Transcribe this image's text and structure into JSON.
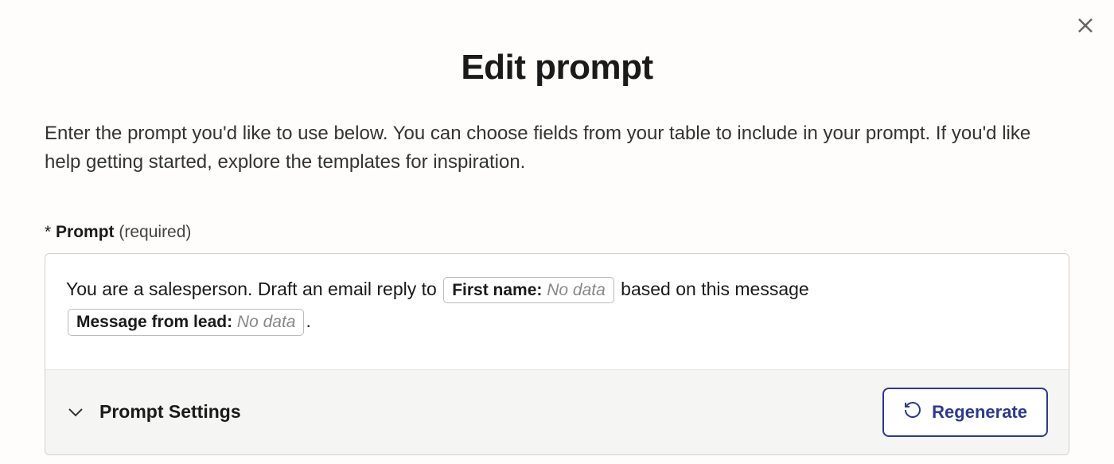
{
  "modal": {
    "title": "Edit prompt",
    "description": "Enter the prompt you'd like to use below. You can choose fields from your table to include in your prompt. If you'd like help getting started, explore the templates for inspiration."
  },
  "prompt": {
    "asterisk": "*",
    "label": "Prompt",
    "required": "(required)",
    "text_part_1": "You are a salesperson. Draft an email reply to ",
    "text_part_2": " based on this message ",
    "text_part_3": ".",
    "chip_1": {
      "label": "First name: ",
      "value": "No data"
    },
    "chip_2": {
      "label": "Message from lead: ",
      "value": "No data"
    }
  },
  "settings": {
    "label": "Prompt Settings"
  },
  "buttons": {
    "regenerate": "Regenerate"
  }
}
